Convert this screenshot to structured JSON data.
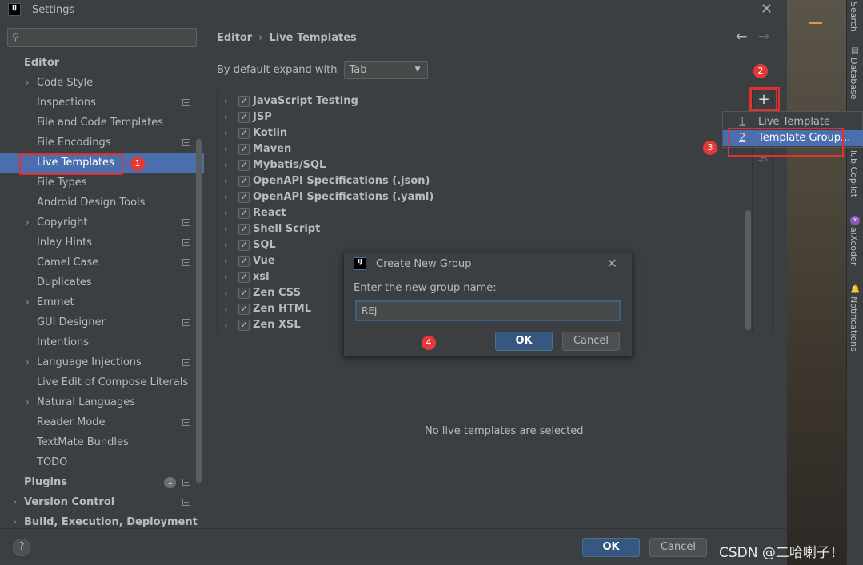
{
  "window": {
    "title": "Settings",
    "logo_text": "IJ"
  },
  "sidebar": {
    "items": [
      {
        "label": "Editor",
        "level": "top",
        "chevron": false,
        "proj": false
      },
      {
        "label": "Code Style",
        "chevron": true,
        "proj": false
      },
      {
        "label": "Inspections",
        "chevron": false,
        "proj": true
      },
      {
        "label": "File and Code Templates",
        "chevron": false,
        "proj": false
      },
      {
        "label": "File Encodings",
        "chevron": false,
        "proj": true
      },
      {
        "label": "Live Templates",
        "chevron": false,
        "proj": false,
        "selected": true
      },
      {
        "label": "File Types",
        "chevron": false,
        "proj": false
      },
      {
        "label": "Android Design Tools",
        "chevron": false,
        "proj": false
      },
      {
        "label": "Copyright",
        "chevron": true,
        "proj": true
      },
      {
        "label": "Inlay Hints",
        "chevron": false,
        "proj": true
      },
      {
        "label": "Camel Case",
        "chevron": false,
        "proj": true
      },
      {
        "label": "Duplicates",
        "chevron": false,
        "proj": false
      },
      {
        "label": "Emmet",
        "chevron": true,
        "proj": false
      },
      {
        "label": "GUI Designer",
        "chevron": false,
        "proj": true
      },
      {
        "label": "Intentions",
        "chevron": false,
        "proj": false
      },
      {
        "label": "Language Injections",
        "chevron": true,
        "proj": true
      },
      {
        "label": "Live Edit of Compose Literals",
        "chevron": false,
        "proj": false
      },
      {
        "label": "Natural Languages",
        "chevron": true,
        "proj": false
      },
      {
        "label": "Reader Mode",
        "chevron": false,
        "proj": true
      },
      {
        "label": "TextMate Bundles",
        "chevron": false,
        "proj": false
      },
      {
        "label": "TODO",
        "chevron": false,
        "proj": false
      },
      {
        "label": "Plugins",
        "level": "top",
        "chevron": false,
        "proj": true,
        "badge": "1"
      },
      {
        "label": "Version Control",
        "level": "top",
        "chevron": true,
        "proj": true
      },
      {
        "label": "Build, Execution, Deployment",
        "level": "top",
        "chevron": true,
        "proj": false
      }
    ]
  },
  "main": {
    "breadcrumb": {
      "parent": "Editor",
      "separator": "›",
      "current": "Live Templates"
    },
    "expand_label": "By default expand with",
    "expand_value": "Tab",
    "groups": [
      "JavaScript Testing",
      "JSP",
      "Kotlin",
      "Maven",
      "Mybatis/SQL",
      "OpenAPI Specifications (.json)",
      "OpenAPI Specifications (.yaml)",
      "React",
      "Shell Script",
      "SQL",
      "Vue",
      "xsl",
      "Zen CSS",
      "Zen HTML",
      "Zen XSL"
    ],
    "empty_message": "No live templates are selected"
  },
  "popup_menu": {
    "items": [
      {
        "num": "1",
        "label": "Live Template"
      },
      {
        "num": "2",
        "label": "Template Group..."
      }
    ]
  },
  "dialog": {
    "title": "Create New Group",
    "prompt": "Enter the new group name:",
    "input_value": "REJ",
    "ok": "OK",
    "cancel": "Cancel"
  },
  "footer": {
    "help": "?",
    "ok": "OK",
    "cancel": "Cancel"
  },
  "tool_strip": [
    "Search",
    "Database",
    "lub Copilot",
    "aiXcoder",
    "Notifications"
  ],
  "markers": [
    "1",
    "2",
    "3",
    "4"
  ],
  "watermark": "CSDN @二哈喇子！",
  "colors": {
    "accent": "#4b6eaf",
    "annotation": "#e53935",
    "background": "#3c3f41"
  }
}
